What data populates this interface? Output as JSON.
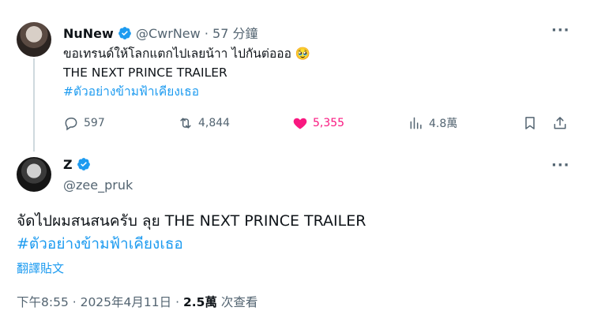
{
  "tweet1": {
    "name": "NuNew",
    "handle": "@CwrNew",
    "dot": "·",
    "time": "57 分鐘",
    "line1": "ขอเทรนด์ให้โลกแตกไปเลยน้าา ไปกันต่อออ 🥹",
    "line2": "THE NEXT PRINCE TRAILER",
    "hashtag": "#ตัวอย่างข้ามฟ้าเคียงเธอ",
    "replies": "597",
    "retweets": "4,844",
    "likes": "5,355",
    "views": "4.8萬"
  },
  "tweet2": {
    "name": "Z",
    "handle": "@zee_pruk",
    "text": "จัดไปผมสนสนครับ ลุย THE NEXT PRINCE TRAILER",
    "hashtag": "#ตัวอย่างข้ามฟ้าเคียงเธอ",
    "translate": "翻譯貼文",
    "timestamp": "下午8:55 · 2025年4月11日",
    "sep": "·",
    "views_count": "2.5萬",
    "views_label": "次查看"
  },
  "colors": {
    "accent": "#1d9bf0",
    "like": "#f91880",
    "secondary_text": "#536471"
  },
  "icons": {
    "reply": "reply-icon",
    "retweet": "retweet-icon",
    "like": "heart-icon",
    "views": "views-icon",
    "bookmark": "bookmark-icon",
    "share": "share-icon",
    "more": "more-icon",
    "verified": "verified-badge-icon"
  }
}
